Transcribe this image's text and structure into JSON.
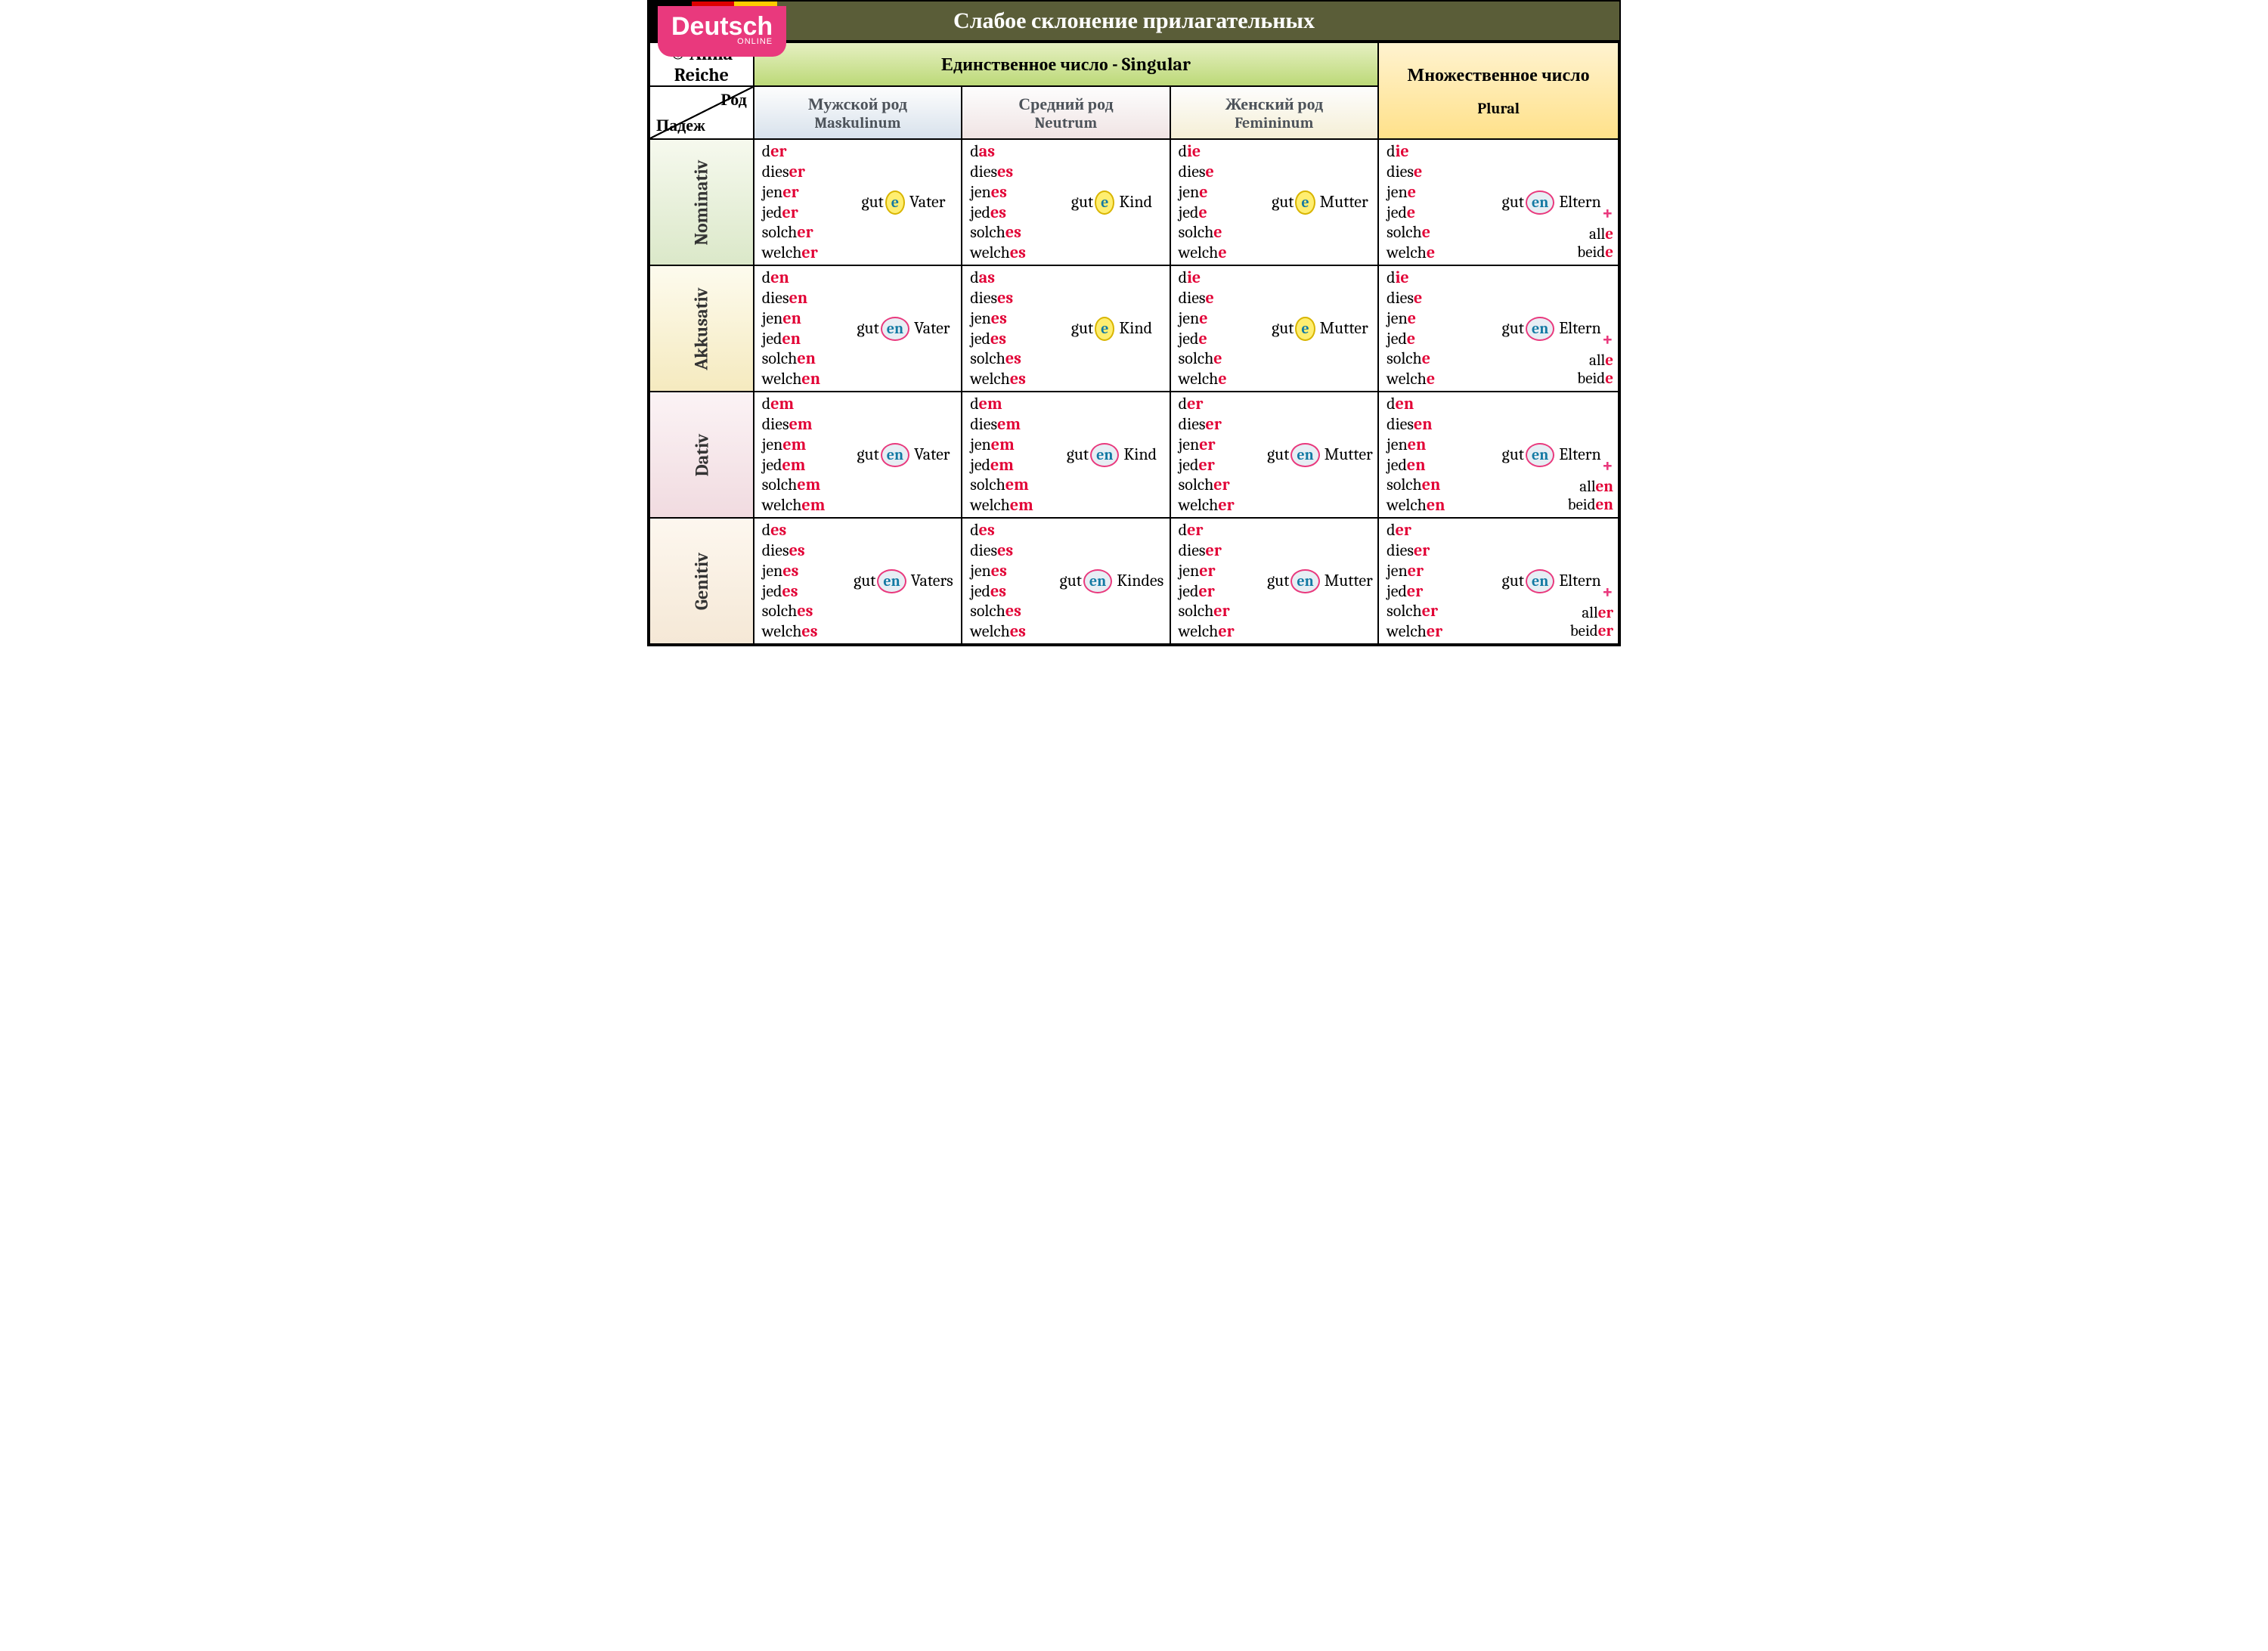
{
  "title": "Слабое склонение прилагательных",
  "logo": {
    "main": "Deutsch",
    "sub": "ONLINE"
  },
  "copyright": "© Anna Reiche",
  "header": {
    "singular": "Единственное число   -   Singular",
    "plural": "Множественное число",
    "pluralSub": "Plural",
    "rod": "Род",
    "padezh": "Падеж"
  },
  "genders": {
    "masc": {
      "ru": "Мужской род",
      "de": "Maskulinum"
    },
    "neut": {
      "ru": "Средний род",
      "de": "Neutrum"
    },
    "fem": {
      "ru": "Женский род",
      "de": "Femininum"
    }
  },
  "cases": [
    {
      "key": "nom",
      "label": "Nominativ",
      "bg": "bg-nom"
    },
    {
      "key": "akk",
      "label": "Akkusativ",
      "bg": "bg-akk"
    },
    {
      "key": "dat",
      "label": "Dativ",
      "bg": "bg-dat"
    },
    {
      "key": "gen",
      "label": "Genitiv",
      "bg": "bg-gen"
    }
  ],
  "detStems": [
    "d",
    "dies",
    "jen",
    "jed",
    "solch",
    "welch"
  ],
  "cells": {
    "nom": {
      "masc": {
        "article": "der",
        "suf": "er",
        "adj": {
          "root": "gut",
          "end": "e",
          "bubble": "e",
          "noun": "Vater"
        }
      },
      "neut": {
        "article": "das",
        "suf": "es",
        "adj": {
          "root": "gut",
          "end": "e",
          "bubble": "e",
          "noun": "Kind"
        }
      },
      "fem": {
        "article": "die",
        "suf": "e",
        "adj": {
          "root": "gut",
          "end": "e",
          "bubble": "e",
          "noun": "Mutter"
        }
      },
      "plur": {
        "article": "die",
        "suf": "e",
        "adj": {
          "root": "gut",
          "end": "en",
          "bubble": "en",
          "noun": "Eltern"
        },
        "plus": [
          {
            "stem": "all",
            "suf": "e"
          },
          {
            "stem": "beid",
            "suf": "e"
          }
        ]
      }
    },
    "akk": {
      "masc": {
        "article": "den",
        "suf": "en",
        "adj": {
          "root": "gut",
          "end": "en",
          "bubble": "en",
          "noun": "Vater"
        }
      },
      "neut": {
        "article": "das",
        "suf": "es",
        "adj": {
          "root": "gut",
          "end": "e",
          "bubble": "e",
          "noun": "Kind"
        }
      },
      "fem": {
        "article": "die",
        "suf": "e",
        "adj": {
          "root": "gut",
          "end": "e",
          "bubble": "e",
          "noun": "Mutter"
        }
      },
      "plur": {
        "article": "die",
        "suf": "e",
        "adj": {
          "root": "gut",
          "end": "en",
          "bubble": "en",
          "noun": "Eltern"
        },
        "plus": [
          {
            "stem": "all",
            "suf": "e"
          },
          {
            "stem": "beid",
            "suf": "e"
          }
        ]
      }
    },
    "dat": {
      "masc": {
        "article": "dem",
        "suf": "em",
        "adj": {
          "root": "gut",
          "end": "en",
          "bubble": "en",
          "noun": "Vater"
        }
      },
      "neut": {
        "article": "dem",
        "suf": "em",
        "adj": {
          "root": "gut",
          "end": "en",
          "bubble": "en",
          "noun": "Kind"
        }
      },
      "fem": {
        "article": "der",
        "suf": "er",
        "adj": {
          "root": "gut",
          "end": "en",
          "bubble": "en",
          "noun": "Mutter"
        }
      },
      "plur": {
        "article": "den",
        "suf": "en",
        "adj": {
          "root": "gut",
          "end": "en",
          "bubble": "en",
          "noun": "Eltern"
        },
        "plus": [
          {
            "stem": "all",
            "suf": "en"
          },
          {
            "stem": "beid",
            "suf": "en"
          }
        ]
      }
    },
    "gen": {
      "masc": {
        "article": "des",
        "suf": "es",
        "adj": {
          "root": "gut",
          "end": "en",
          "bubble": "en",
          "noun": "Vaters"
        }
      },
      "neut": {
        "article": "des",
        "suf": "es",
        "adj": {
          "root": "gut",
          "end": "en",
          "bubble": "en",
          "noun": "Kindes"
        }
      },
      "fem": {
        "article": "der",
        "suf": "er",
        "adj": {
          "root": "gut",
          "end": "en",
          "bubble": "en",
          "noun": "Mutter"
        }
      },
      "plur": {
        "article": "der",
        "suf": "er",
        "adj": {
          "root": "gut",
          "end": "en",
          "bubble": "en",
          "noun": "Eltern"
        },
        "plus": [
          {
            "stem": "all",
            "suf": "er"
          },
          {
            "stem": "beid",
            "suf": "er"
          }
        ]
      }
    }
  }
}
